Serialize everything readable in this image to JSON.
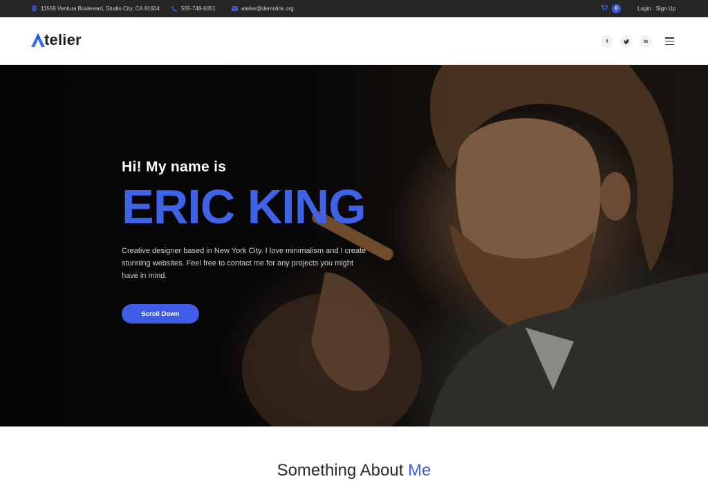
{
  "topbar": {
    "address": "11559 Ventura Boulevard, Studio City, CA 91604",
    "phone": "555-748-6051",
    "email": "atelier@demolink.org",
    "cart_count": "0",
    "login": "Login",
    "signup": "Sign Up",
    "icons": [
      "map-pin-icon",
      "phone-icon",
      "envelope-icon",
      "cart-icon"
    ]
  },
  "header": {
    "logo_letter": "A",
    "logo_rest": "telier",
    "socials": [
      {
        "name": "facebook-icon",
        "label": "f"
      },
      {
        "name": "twitter-icon",
        "label": "t"
      },
      {
        "name": "linkedin-icon",
        "label": "in"
      }
    ],
    "menu_icon": "hamburger-menu-icon"
  },
  "hero": {
    "greeting": "Hi! My name is",
    "name": "ERIC KING",
    "description": "Creative designer based in New York City. I love minimalism and I create stunning websites. Feel free to contact me for any projects you might have in mind.",
    "button": "Scroll Down"
  },
  "about": {
    "title_main": "Something About",
    "title_highlight": "Me"
  },
  "colors": {
    "accent": "#3e5ce8",
    "topbar_bg": "#262626"
  }
}
